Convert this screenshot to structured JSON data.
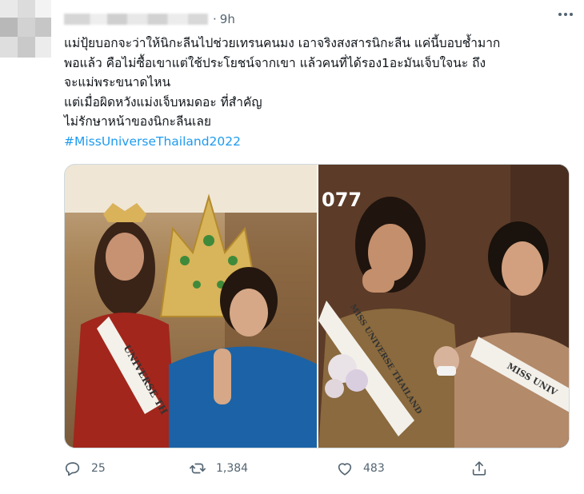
{
  "tweet": {
    "time": "9h",
    "separator": "·",
    "text_lines": [
      "แม่ปุ้ยบอกจะว่าให้นิกะลีนไปช่วยเทรนคนมง  เอาจริงสงสารนิกะลีน แค่นี้บอบช้ำมาก",
      "พอแล้ว คือไม่ซื้อเขาแต่ใช้ประโยชน์จากเขา แล้วคนที่ได้รอง1อะมันเจ็บใจนะ ถึง",
      "จะแม่พระขนาดไหน",
      "แต่เมื่อผิดหวังแม่งเจ็บหมดอะ ที่สำคัญ",
      "ไม่รักษาหน้าของนิกะลีนเลย"
    ],
    "hashtag": "#MissUniverseThailand2022"
  },
  "media": {
    "left_sash_text": "UNIVERSE TH",
    "right_overlay_text": "077",
    "right_sash_text_left": "MISS UNIVERSE THAILAND",
    "right_sash_text_right": "MISS UNIV"
  },
  "actions": {
    "reply_count": "25",
    "retweet_count": "1,384",
    "like_count": "483"
  },
  "icons": {
    "reply": "reply-icon",
    "retweet": "retweet-icon",
    "like": "heart-icon",
    "share": "share-icon",
    "more": "more-icon"
  },
  "colors": {
    "text": "#0f1419",
    "secondary": "#536471",
    "hashtag": "#1d9bf0",
    "border": "#cfd9de"
  }
}
